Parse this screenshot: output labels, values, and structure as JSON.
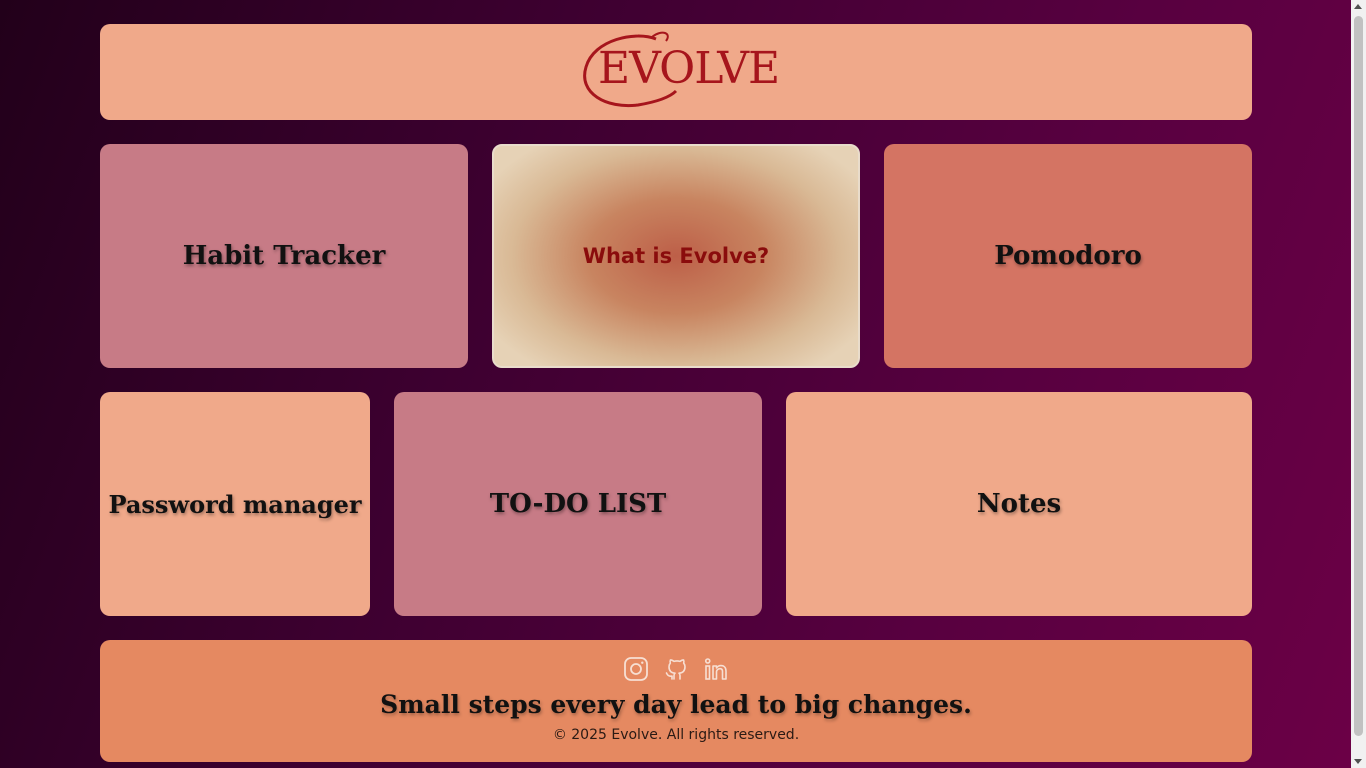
{
  "header": {
    "logo_text": "EVOLVE"
  },
  "cards": {
    "habit": "Habit Tracker",
    "about": "What is Evolve?",
    "pomodoro": "Pomodoro",
    "password": "Password manager",
    "todo": "TO-DO LIST",
    "notes": "Notes"
  },
  "footer": {
    "social_icons": [
      "instagram-icon",
      "github-icon",
      "linkedin-icon"
    ],
    "tagline": "Small steps every day lead to big changes.",
    "copyright": "© 2025 Evolve. All rights reserved."
  },
  "colors": {
    "background": "#3d0030",
    "accent_peach": "#f0a98a",
    "accent_rose": "#c77b86",
    "accent_coral": "#d47463",
    "footer": "#e58961",
    "logo": "#a6151c"
  }
}
